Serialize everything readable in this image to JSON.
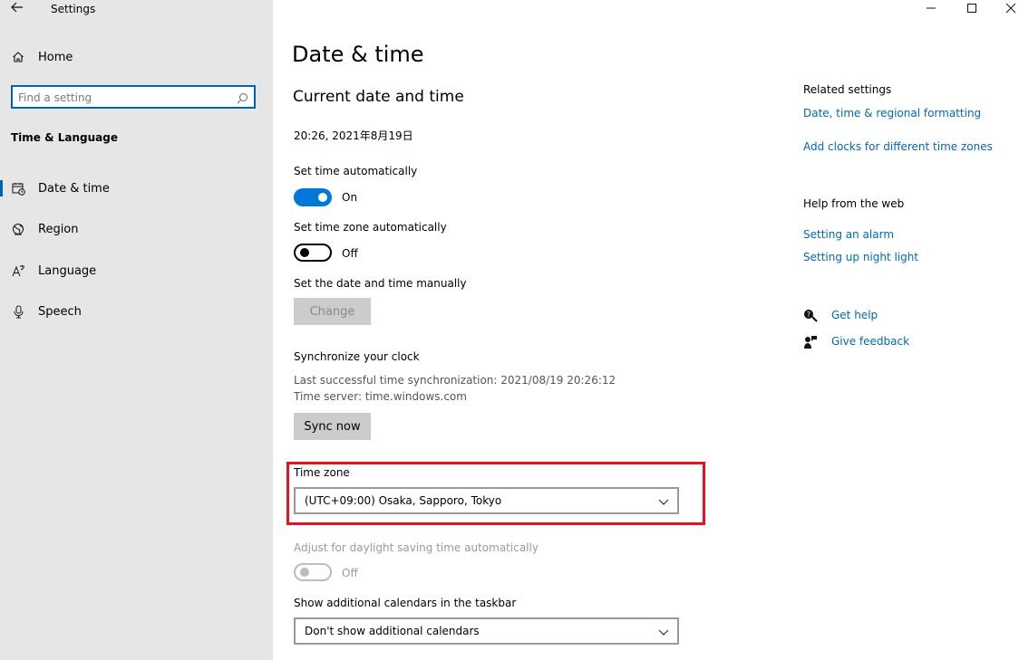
{
  "window": {
    "title": "Settings",
    "back_icon": "back-arrow-icon",
    "controls": {
      "minimize": "—",
      "maximize": "☐",
      "close": "✕"
    }
  },
  "sidebar": {
    "home_label": "Home",
    "search_placeholder": "Find a setting",
    "section": "Time & Language",
    "items": [
      {
        "label": "Date & time",
        "icon": "calendar-clock-icon",
        "selected": true
      },
      {
        "label": "Region",
        "icon": "globe-icon",
        "selected": false
      },
      {
        "label": "Language",
        "icon": "language-icon",
        "selected": false
      },
      {
        "label": "Speech",
        "icon": "microphone-icon",
        "selected": false
      }
    ]
  },
  "main": {
    "title": "Date & time",
    "subtitle": "Current date and time",
    "current_datetime": "20:26, 2021年8月19日",
    "set_time_auto": {
      "label": "Set time automatically",
      "state": "On",
      "on": true
    },
    "set_zone_auto": {
      "label": "Set time zone automatically",
      "state": "Off",
      "on": false
    },
    "manual": {
      "label": "Set the date and time manually",
      "button": "Change"
    },
    "sync": {
      "label": "Synchronize your clock",
      "last_sync": "Last successful time synchronization: 2021/08/19 20:26:12",
      "server": "Time server: time.windows.com",
      "button": "Sync now"
    },
    "time_zone": {
      "label": "Time zone",
      "value": "(UTC+09:00) Osaka, Sapporo, Tokyo"
    },
    "dst": {
      "label": "Adjust for daylight saving time automatically",
      "state": "Off",
      "on": false,
      "disabled": true
    },
    "calendars": {
      "label": "Show additional calendars in the taskbar",
      "value": "Don't show additional calendars"
    }
  },
  "right": {
    "related_heading": "Related settings",
    "related_links": [
      "Date, time & regional formatting",
      "Add clocks for different time zones"
    ],
    "help_heading": "Help from the web",
    "help_links": [
      "Setting an alarm",
      "Setting up night light"
    ],
    "get_help": "Get help",
    "give_feedback": "Give feedback"
  },
  "colors": {
    "accent": "#0078d7",
    "link": "#0067b8",
    "highlight": "#e3141f",
    "sidebar_bg": "#e6e6e6"
  }
}
